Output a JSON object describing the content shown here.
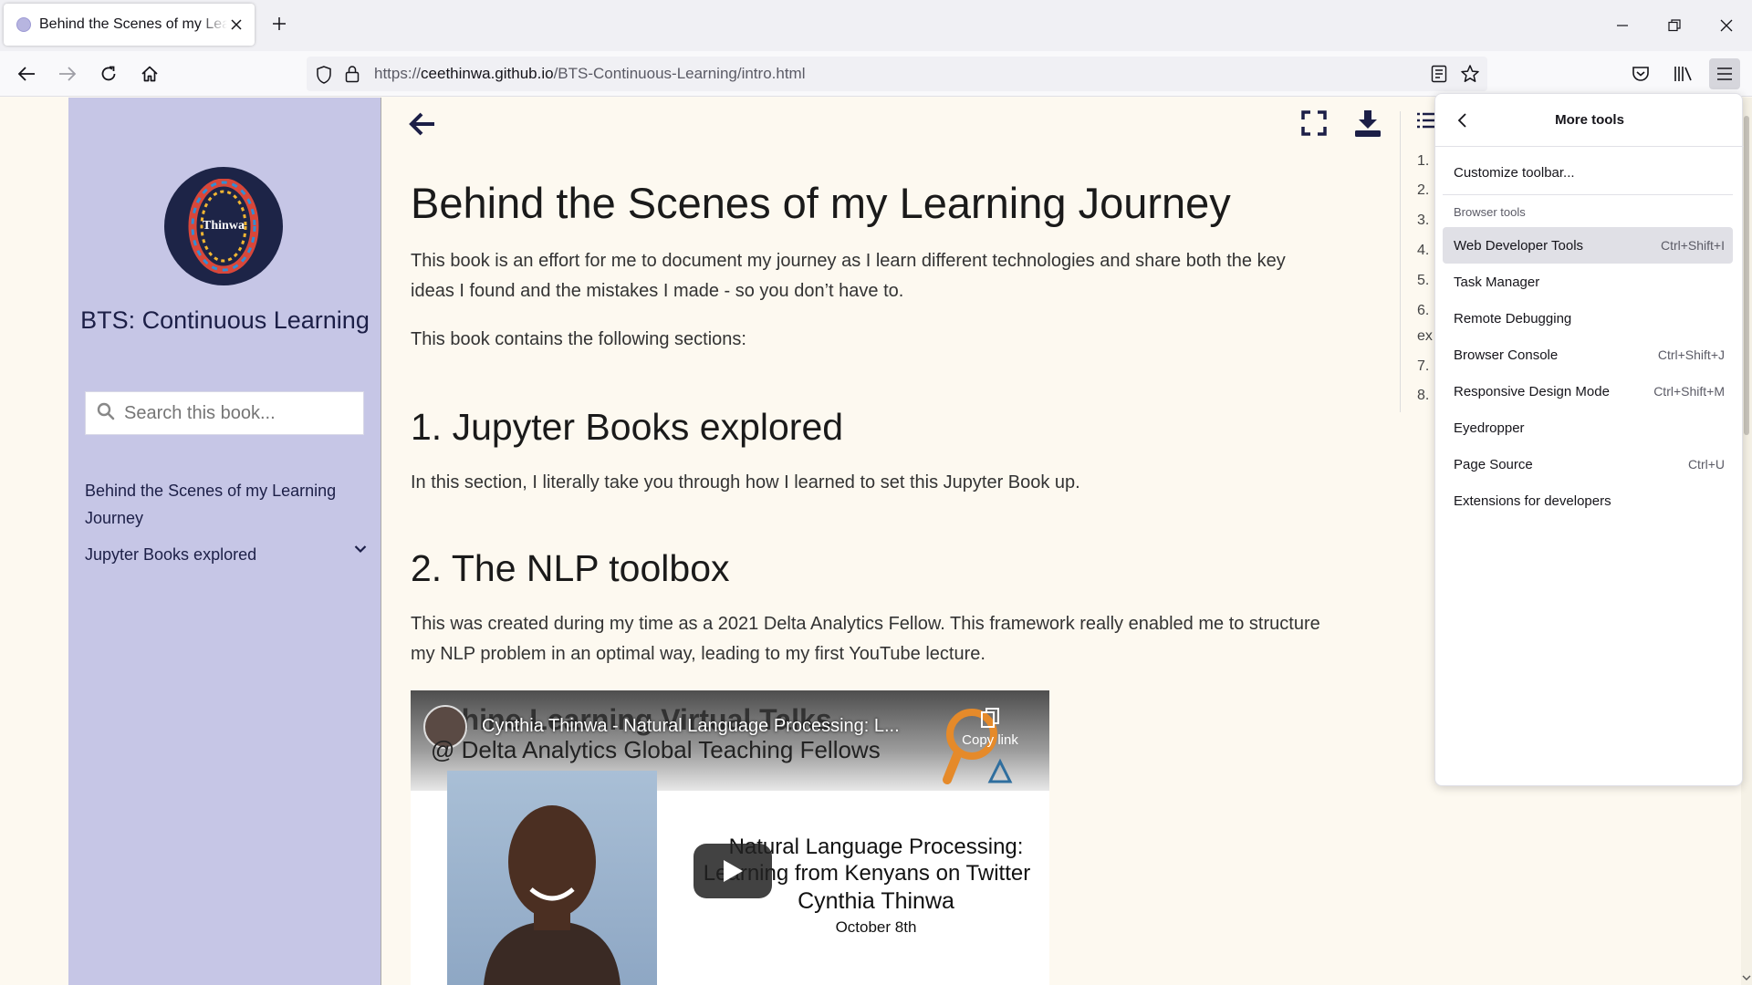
{
  "tab": {
    "title": "Behind the Scenes of my Learning Journey"
  },
  "url": {
    "prefix": "https://",
    "host": "ceethinwa.github.io",
    "path": "/BTS-Continuous-Learning/intro.html"
  },
  "sidebar": {
    "logo_text": "Thinwa",
    "title": "BTS: Continuous Learning",
    "search_placeholder": "Search this book...",
    "items": [
      {
        "label": "Behind the Scenes of my Learning Journey"
      },
      {
        "label": "Jupyter Books explored"
      }
    ]
  },
  "article": {
    "title": "Behind the Scenes of my Learning Journey",
    "intro": "This book is an effort for me to document my journey as I learn different technologies and share both the key ideas I found and the mistakes I made - so you don’t have to.",
    "sections_intro": "This book contains the following sections:",
    "section1_title": "1. Jupyter Books explored",
    "section1_text": "In this section, I literally take you through how I learned to set this Jupyter Book up.",
    "section2_title": "2. The NLP toolbox",
    "section2_text": "This was created during my time as a 2021 Delta Analytics Fellow. This framework really enabled me to structure my NLP problem in an optimal way, leading to my first YouTube lecture."
  },
  "video": {
    "bg_title": "achine Learning Virtual Talks",
    "overlay_title": "Cynthia Thinwa - Natural Language Processing: L...",
    "subtitle": "@ Delta Analytics Global Teaching Fellows",
    "copy_link": "Copy link",
    "line1": "Natural Language Processing:",
    "line2": "Learning from Kenyans on Twitter",
    "line3": "Cynthia Thinwa",
    "line4": "October 8th"
  },
  "toc": {
    "numbers": [
      "1.",
      "2.",
      "3.",
      "4.",
      "5.",
      "6.",
      "ex",
      "7.",
      "8."
    ]
  },
  "panel": {
    "title": "More tools",
    "customize": "Customize toolbar...",
    "section_label": "Browser tools",
    "items": [
      {
        "label": "Web Developer Tools",
        "shortcut": "Ctrl+Shift+I"
      },
      {
        "label": "Task Manager",
        "shortcut": ""
      },
      {
        "label": "Remote Debugging",
        "shortcut": ""
      },
      {
        "label": "Browser Console",
        "shortcut": "Ctrl+Shift+J"
      },
      {
        "label": "Responsive Design Mode",
        "shortcut": "Ctrl+Shift+M"
      },
      {
        "label": "Eyedropper",
        "shortcut": ""
      },
      {
        "label": "Page Source",
        "shortcut": "Ctrl+U"
      },
      {
        "label": "Extensions for developers",
        "shortcut": ""
      }
    ]
  },
  "colors": {
    "sidebar_bg": "#c6c6e6",
    "page_bg": "#fdf9f0",
    "accent_navy": "#1c1f47",
    "panel_highlight": "#e0e0e6"
  }
}
